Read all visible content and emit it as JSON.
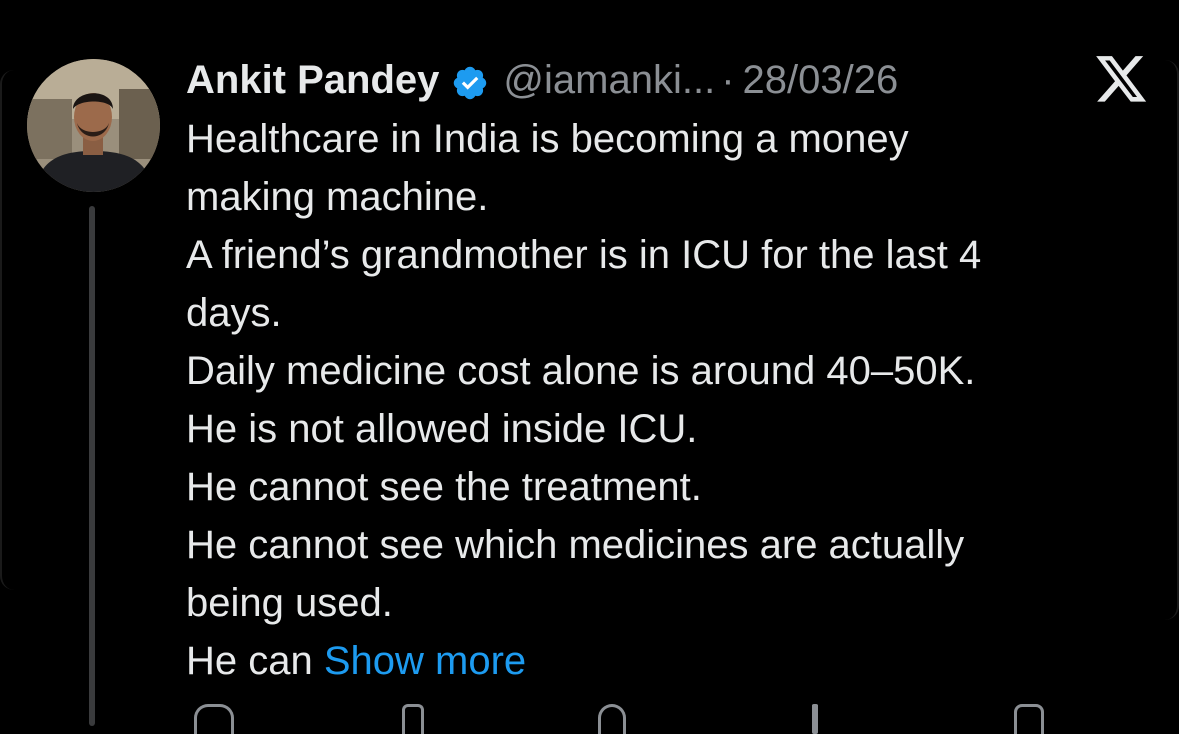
{
  "tweet": {
    "author_name": "Ankit Pandey",
    "handle": "@iamanki...",
    "separator": "·",
    "date": "28/03/26",
    "verified": true,
    "body_lines": [
      "Healthcare in India is becoming a money",
      "making machine.",
      "A friend’s grandmother is in ICU for the last 4",
      "days.",
      "Daily medicine cost alone is around 40–50K.",
      "He is not allowed inside ICU.",
      "He cannot see the treatment.",
      "He cannot see which medicines are actually",
      "being used."
    ],
    "last_line_prefix": "He can ",
    "show_more_label": "Show more"
  },
  "icons": {
    "verified": "verified-badge-icon",
    "brand": "x-logo-icon",
    "avatar": "profile-photo"
  },
  "colors": {
    "background": "#000000",
    "primary_text": "#e7e9ea",
    "secondary_text": "#8b8f94",
    "link": "#1d9bf0",
    "verified_badge": "#1d9bf0",
    "thread_line": "#3a3b3d"
  }
}
